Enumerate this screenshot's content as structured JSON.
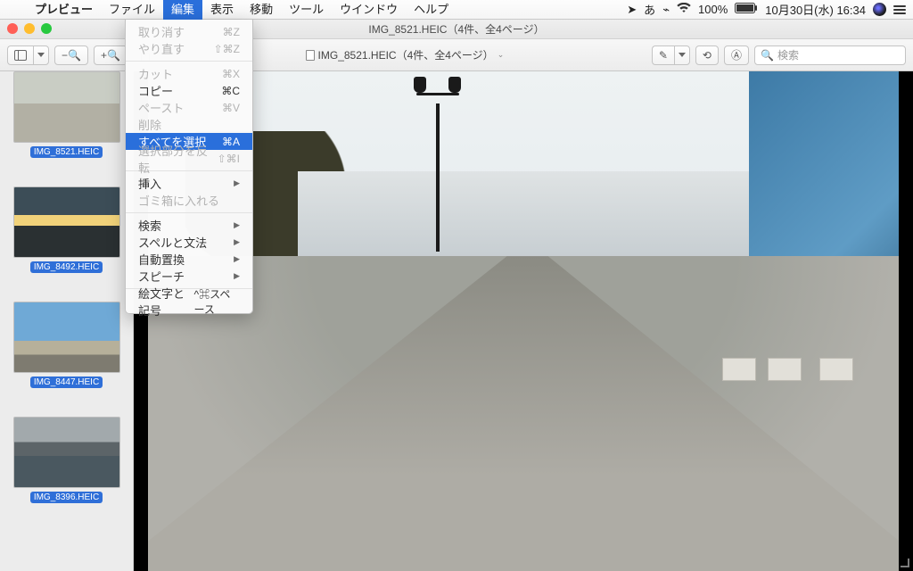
{
  "menubar": {
    "app_name": "プレビュー",
    "items": [
      "ファイル",
      "編集",
      "表示",
      "移動",
      "ツール",
      "ウインドウ",
      "ヘルプ"
    ],
    "active_index": 1
  },
  "status": {
    "battery_text": "100%",
    "datetime": "10月30日(水) 16:34"
  },
  "titlebar": {
    "title": "IMG_8521.HEIC（4件、全4ページ）"
  },
  "toolbar": {
    "doc_label": "IMG_8521.HEIC（4件、全4ページ）",
    "search_placeholder": "検索"
  },
  "sidebar": {
    "thumbs": [
      {
        "label": "IMG_8521.HEIC",
        "selected": true,
        "cls": "th1"
      },
      {
        "label": "IMG_8492.HEIC",
        "selected": true,
        "cls": "th2"
      },
      {
        "label": "IMG_8447.HEIC",
        "selected": true,
        "cls": "th3"
      },
      {
        "label": "IMG_8396.HEIC",
        "selected": true,
        "cls": "th4"
      }
    ]
  },
  "edit_menu": {
    "items": [
      {
        "label": "取り消す",
        "shortcut": "⌘Z",
        "disabled": true
      },
      {
        "label": "やり直す",
        "shortcut": "⇧⌘Z",
        "disabled": true
      },
      {
        "sep": true
      },
      {
        "label": "カット",
        "shortcut": "⌘X",
        "disabled": true
      },
      {
        "label": "コピー",
        "shortcut": "⌘C",
        "disabled": false
      },
      {
        "label": "ペースト",
        "shortcut": "⌘V",
        "disabled": true
      },
      {
        "label": "削除",
        "shortcut": "",
        "disabled": true
      },
      {
        "label": "すべてを選択",
        "shortcut": "⌘A",
        "disabled": false,
        "highlight": true
      },
      {
        "label": "選択部分を反転",
        "shortcut": "⇧⌘I",
        "disabled": true
      },
      {
        "sep": true
      },
      {
        "label": "挿入",
        "submenu": true,
        "disabled": false
      },
      {
        "label": "ゴミ箱に入れる",
        "shortcut": "",
        "disabled": true
      },
      {
        "sep": true
      },
      {
        "label": "検索",
        "submenu": true,
        "disabled": false
      },
      {
        "label": "スペルと文法",
        "submenu": true,
        "disabled": false
      },
      {
        "label": "自動置換",
        "submenu": true,
        "disabled": false
      },
      {
        "label": "スピーチ",
        "submenu": true,
        "disabled": false
      },
      {
        "sep": true
      },
      {
        "label": "絵文字と記号",
        "shortcut": "^⌘スペース",
        "disabled": false
      }
    ]
  }
}
